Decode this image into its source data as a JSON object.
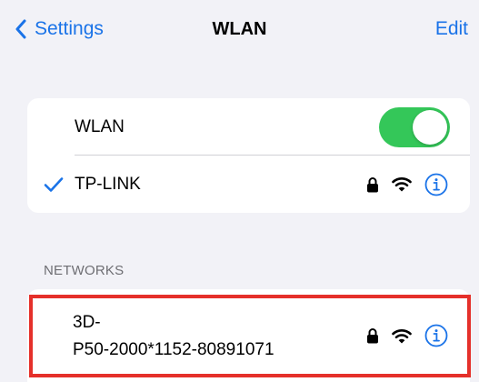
{
  "nav": {
    "back_label": "Settings",
    "title": "WLAN",
    "edit_label": "Edit"
  },
  "wlan_card": {
    "toggle_label": "WLAN",
    "toggle_on": true,
    "connected_network": "TP-LINK"
  },
  "networks": {
    "header": "NETWORKS",
    "items": [
      {
        "name_line1": "3D-",
        "name_line2": "P50-2000*1152-80891071",
        "secured": true
      }
    ]
  },
  "colors": {
    "accent": "#1a73e8",
    "toggle_on": "#34c759",
    "highlight_border": "#e5302a"
  }
}
